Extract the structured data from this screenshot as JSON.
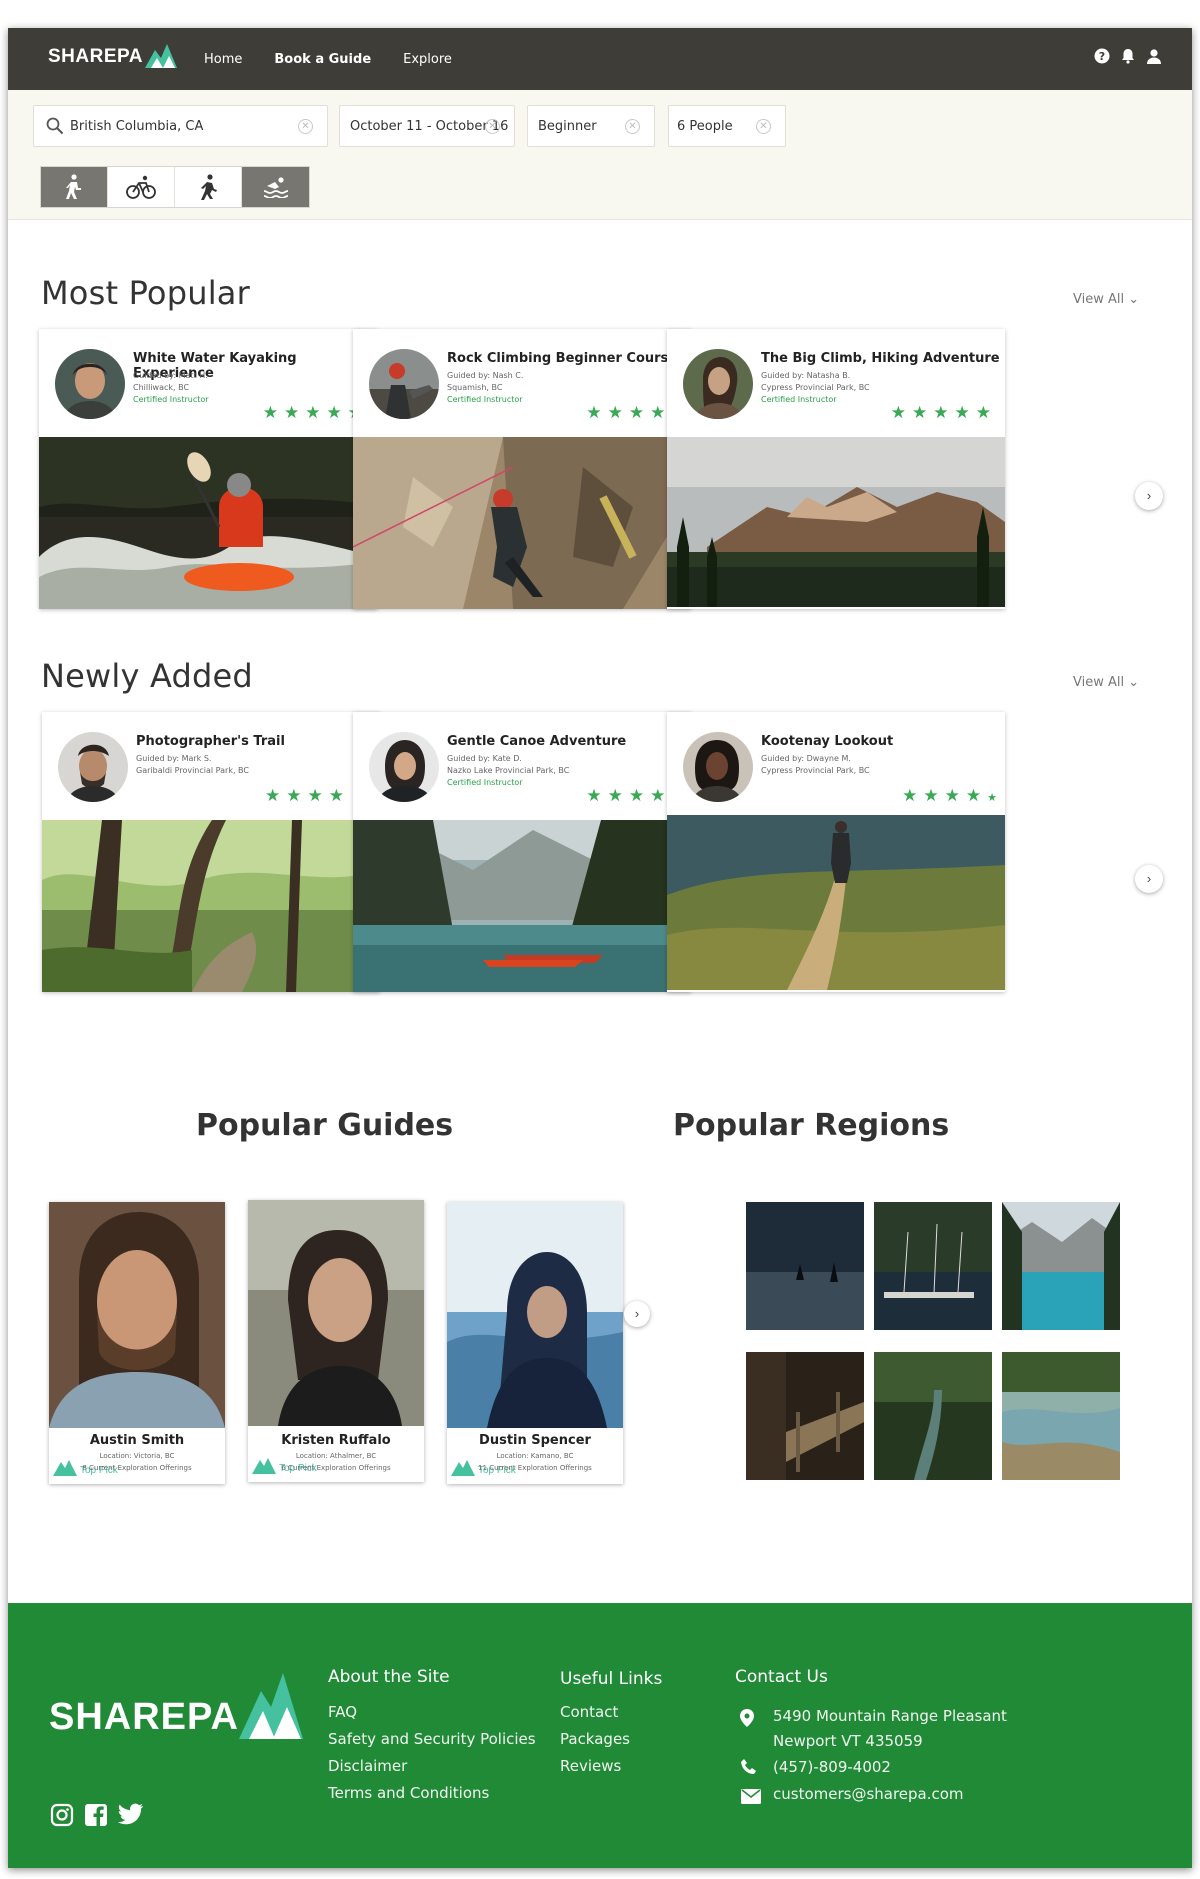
{
  "nav": {
    "brand": "SHAREPA",
    "links": [
      "Home",
      "Book a Guide",
      "Explore"
    ]
  },
  "filters": {
    "location": {
      "value": "British Columbia, CA"
    },
    "dates": {
      "value": "October 11 - October 16"
    },
    "level": {
      "value": "Beginner"
    },
    "people": {
      "value": "6 People"
    },
    "activities": [
      "hiking-icon",
      "cycling-icon",
      "climbing-icon",
      "swimming-icon"
    ]
  },
  "most_popular": {
    "title": "Most Popular",
    "view_all": "View All",
    "cards": [
      {
        "title": "White Water Kayaking Experience",
        "guide": "Guided by: Matt H.",
        "location": "Chilliwack, BC",
        "cert": "Certified Instructor",
        "rating": 5
      },
      {
        "title": "Rock Climbing Beginner Course",
        "guide": "Guided by: Nash C.",
        "location": "Squamish, BC",
        "cert": "Certified Instructor",
        "rating": 4.5
      },
      {
        "title": "The Big Climb, Hiking Adventure",
        "guide": "Guided by: Natasha B.",
        "location": "Cypress Provincial Park, BC",
        "cert": "Certified Instructor",
        "rating": 5
      }
    ]
  },
  "newly_added": {
    "title": "Newly Added",
    "view_all": "View All",
    "cards": [
      {
        "title": "Photographer's Trail",
        "guide": "Guided by: Mark S.",
        "location": "Garibaldi Provincial Park, BC",
        "cert": "",
        "rating": 4
      },
      {
        "title": "Gentle Canoe Adventure",
        "guide": "Guided by: Kate D.",
        "location": "Nazko Lake Provincial Park, BC",
        "cert": "Certified Instructor",
        "rating": 4.5
      },
      {
        "title": "Kootenay Lookout",
        "guide": "Guided by: Dwayne M.",
        "location": "Cypress Provincial Park, BC",
        "cert": "",
        "rating": 4.3
      }
    ]
  },
  "popular_guides": {
    "title": "Popular Guides",
    "badge": "Top Pick",
    "guides": [
      {
        "name": "Austin Smith",
        "location": "Location: Victoria, BC",
        "offerings": "8 Current Exploration Offerings"
      },
      {
        "name": "Kristen Ruffalo",
        "location": "Location: Athalmer, BC",
        "offerings": "6 Current Exploration Offerings"
      },
      {
        "name": "Dustin Spencer",
        "location": "Location: Kamano, BC",
        "offerings": "11 Current Exploration Offerings"
      }
    ]
  },
  "popular_regions": {
    "title": "Popular Regions"
  },
  "footer": {
    "brand": "SHAREPA",
    "about": {
      "title": "About the Site",
      "links": [
        "FAQ",
        "Safety and Security Policies",
        "Disclaimer",
        "Terms and Conditions"
      ]
    },
    "useful": {
      "title": "Useful Links",
      "links": [
        "Contact",
        "Packages",
        "Reviews"
      ]
    },
    "contact": {
      "title": "Contact Us",
      "address_line1": "5490 Mountain Range Pleasant",
      "address_line2": "Newport VT 435059",
      "phone": "(457)-809-4002",
      "email": "customers@sharepa.com"
    }
  },
  "colors": {
    "nav": "#3e3d37",
    "accent": "#218a37",
    "stars": "#3aa855",
    "filterbar": "#f8f7f0"
  }
}
